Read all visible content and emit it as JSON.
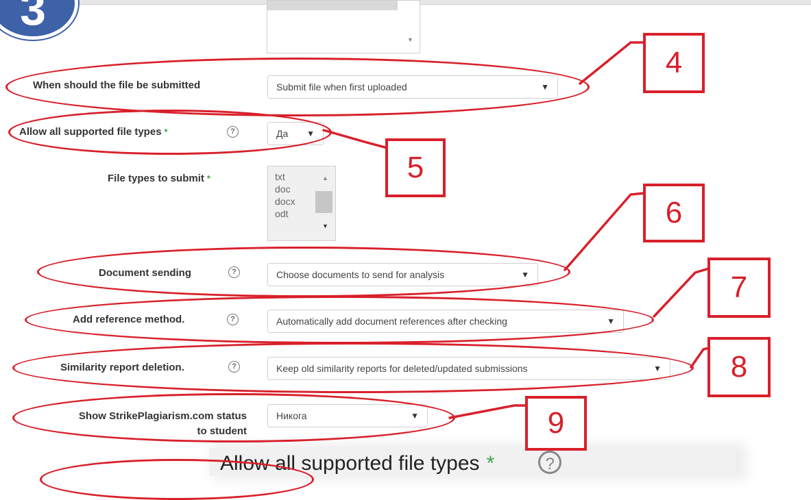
{
  "step_badge": "3",
  "top_listbox": {
    "scroll_down": "▼"
  },
  "fields": {
    "when_submitted": {
      "label": "When should the file be submitted",
      "value": "Submit file when first uploaded"
    },
    "allow_all_types": {
      "label": "Allow all supported file types",
      "required_mark": "*",
      "help": "?",
      "value": "Да"
    },
    "file_types": {
      "label": "File types to submit",
      "required_mark": "*",
      "options": [
        "txt",
        "doc",
        "docx",
        "odt"
      ],
      "scroll_up": "▲",
      "scroll_down": "▼"
    },
    "document_sending": {
      "label": "Document sending",
      "help": "?",
      "value": "Choose documents to send for analysis"
    },
    "reference_method": {
      "label": "Add reference method.",
      "help": "?",
      "value": "Automatically add document references after checking"
    },
    "report_deletion": {
      "label": "Similarity report deletion.",
      "help": "?",
      "value": "Keep old similarity reports for deleted/updated submissions"
    },
    "show_status": {
      "label_line1": "Show StrikePlagiarism.com status",
      "label_line2": "to student",
      "value": "Никога"
    }
  },
  "dropdown_arrow": "▼",
  "callouts": [
    "4",
    "5",
    "6",
    "7",
    "8",
    "9"
  ],
  "zoomed": {
    "label": "Allow all supported file types",
    "required_mark": "*",
    "help": "?"
  },
  "colors": {
    "annotation_red": "#d8202a",
    "badge_blue": "#3e62a8",
    "required_green": "#3fa34d"
  }
}
